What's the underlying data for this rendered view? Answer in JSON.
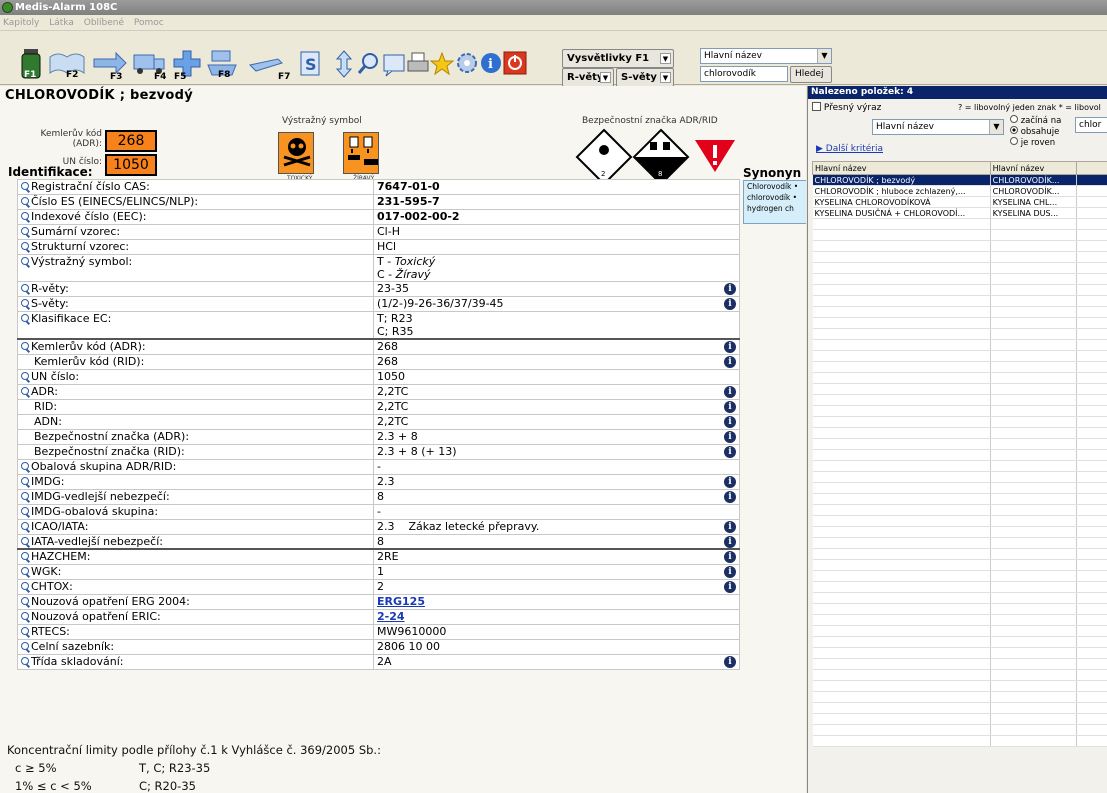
{
  "window": {
    "title": "Medis-Alarm 108C"
  },
  "menu": [
    "Kapitoly",
    "Látka",
    "Oblíbené",
    "Pomoc"
  ],
  "toolbar": {
    "f_labels": [
      "F1",
      "F2",
      "F3",
      "F4",
      "F5",
      "F8",
      "F7"
    ],
    "vysvetlivky": "Vysvětlivky F1",
    "r_vety": "R-věty",
    "s_vety": "S-věty",
    "field_select": "Hlavní název",
    "search_value": "chlorovodík",
    "search_button": "Hledej"
  },
  "substance": {
    "name": "CHLOROVODÍK ; bezvodý",
    "kemler_label": "Kemlerův kód\n(ADR):",
    "kemler_value": "268",
    "un_label": "UN číslo:",
    "un_value": "1050",
    "hazard_symbol_label": "Výstražný symbol",
    "hazard_symbols": [
      {
        "icon": "toxic-skull",
        "caption": "TOXICKÝ"
      },
      {
        "icon": "corrosive",
        "caption": "ŽÍRAVÝ"
      }
    ],
    "adr_label": "Bezpečnostní značka ADR/RID",
    "adr_signs": [
      {
        "icon": "toxic-gas-diamond",
        "number": "2"
      },
      {
        "icon": "corrosive-diamond",
        "number": "8"
      },
      {
        "icon": "red-triangle",
        "number": ""
      }
    ]
  },
  "identification_title": "Identifikace:",
  "synonyms_title": "Synonyn",
  "synonyms": [
    "Chlorovodík •",
    "chlorovodík •",
    "hydrogen ch"
  ],
  "properties": [
    {
      "key": "Registrační číslo CAS:",
      "value": "7647-01-0",
      "mag": true,
      "bold": true
    },
    {
      "key": "Číslo ES (EINECS/ELINCS/NLP):",
      "value": "231-595-7",
      "mag": true,
      "bold": true
    },
    {
      "key": "Indexové číslo (EEC):",
      "value": "017-002-00-2",
      "mag": true,
      "bold": true
    },
    {
      "key": "Sumární vzorec:",
      "value": "Cl-H",
      "mag": true
    },
    {
      "key": "Strukturní vzorec:",
      "value": "HCl",
      "mag": true
    },
    {
      "key": "Výstražný symbol:",
      "value": "T - Toxický\nC - Žíravý",
      "mag": true,
      "italic2": true
    },
    {
      "key": "R-věty:",
      "value": "23-35",
      "mag": true,
      "info": true
    },
    {
      "key": "S-věty:",
      "value": "(1/2-)9-26-36/37/39-45",
      "mag": true,
      "info": true
    },
    {
      "key": "Klasifikace EC:",
      "value": "T; R23\nC; R35",
      "mag": true
    },
    {
      "key": "Kemlerův kód (ADR):",
      "value": "268",
      "mag": true,
      "info": true,
      "sep": true
    },
    {
      "key": "Kemlerův kód (RID):",
      "value": "268",
      "info": true,
      "indent": true
    },
    {
      "key": "UN číslo:",
      "value": "1050",
      "mag": true
    },
    {
      "key": "ADR:",
      "value": "2,2TC",
      "mag": true,
      "info": true
    },
    {
      "key": "RID:",
      "value": "2,2TC",
      "info": true,
      "indent": true
    },
    {
      "key": "ADN:",
      "value": "2,2TC",
      "info": true,
      "indent": true
    },
    {
      "key": "Bezpečnostní značka (ADR):",
      "value": "2.3 + 8",
      "info": true,
      "indent": true
    },
    {
      "key": "Bezpečnostní značka (RID):",
      "value": "2.3 + 8 (+ 13)",
      "info": true,
      "indent": true
    },
    {
      "key": "Obalová skupina ADR/RID:",
      "value": "-",
      "mag": true
    },
    {
      "key": "IMDG:",
      "value": "2.3",
      "mag": true,
      "info": true
    },
    {
      "key": "IMDG-vedlejší nebezpečí:",
      "value": "8",
      "mag": true,
      "info": true
    },
    {
      "key": "IMDG-obalová skupina:",
      "value": "-",
      "mag": true
    },
    {
      "key": "ICAO/IATA:",
      "value": "2.3    Zákaz letecké přepravy.",
      "mag": true,
      "info": true
    },
    {
      "key": "IATA-vedlejší nebezpečí:",
      "value": "8",
      "mag": true,
      "info": true
    },
    {
      "key": "HAZCHEM:",
      "value": "2RE",
      "mag": true,
      "info": true,
      "sep": true
    },
    {
      "key": "WGK:",
      "value": "1",
      "mag": true,
      "info": true
    },
    {
      "key": "CHTOX:",
      "value": "2",
      "mag": true,
      "info": true
    },
    {
      "key": "Nouzová opatření ERG 2004:",
      "value": "ERG125",
      "mag": true,
      "link": true
    },
    {
      "key": "Nouzová opatření ERIC:",
      "value": "2-24",
      "mag": true,
      "link": true
    },
    {
      "key": "RTECS:",
      "value": "MW9610000",
      "mag": true
    },
    {
      "key": "Celní sazebník:",
      "value": "2806 10 00",
      "mag": true
    },
    {
      "key": "Třída skladování:",
      "value": "2A",
      "mag": true,
      "info": true
    }
  ],
  "footer": {
    "title": "Koncentrační limity podle přílohy č.1 k Vyhlášce č. 369/2005 Sb.:",
    "rows": [
      {
        "c": "c ≥ 5%",
        "v": "T, C; R23-35"
      },
      {
        "c": "1% ≤ c < 5%",
        "v": "C; R20-35"
      }
    ]
  },
  "results": {
    "title": "Nalezeno položek: 4",
    "exact_label": "Přesný výraz",
    "wildcard_hint": "? = libovolný jeden znak  * = libovol",
    "field_select": "Hlavní název",
    "radio": [
      "začíná na",
      "obsahuje",
      "je roven"
    ],
    "radio_selected": 1,
    "search_value": "chlor",
    "more_criteria": "Další kritéria",
    "columns": [
      "Hlavní název",
      "Hlavní název"
    ],
    "rows": [
      [
        "CHLOROVODÍK ; bezvodý",
        "CHLOROVODÍK..."
      ],
      [
        "CHLOROVODÍK ; hluboce zchlazený,...",
        "CHLOROVODÍK..."
      ],
      [
        "KYSELINA CHLOROVODÍKOVÁ",
        "KYSELINA CHL..."
      ],
      [
        "KYSELINA DUSIČNÁ + CHLOROVODÍ...",
        "KYSELINA DUS..."
      ]
    ],
    "selected_row": 0
  }
}
